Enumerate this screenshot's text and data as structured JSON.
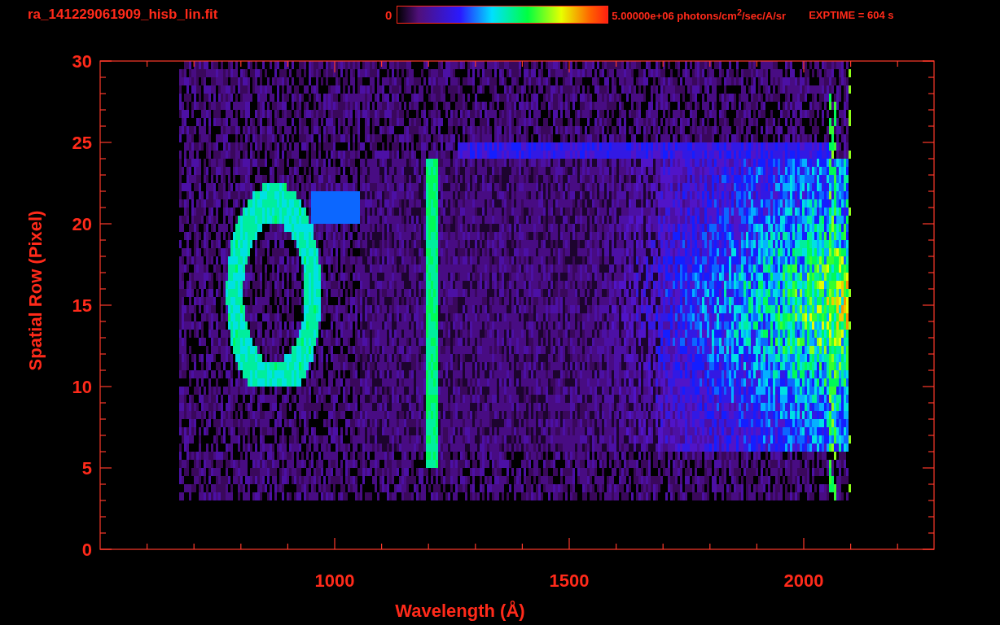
{
  "header": {
    "filename": "ra_141229061909_hisb_lin.fit",
    "colorbar": {
      "min_label": "0",
      "max_label": "5.00000e+06 photons/cm$^{2}$/sec/A/sr"
    },
    "exposure": "EXPTIME = 604 s"
  },
  "plot": {
    "ylabel": "Spatial Row (Pixel)",
    "xlabel": "Wavelength (Å)",
    "yticks": [
      "30",
      "25",
      "20",
      "15",
      "10",
      "5",
      "0"
    ],
    "xticks": [
      "1000",
      "1500",
      "2000"
    ]
  }
}
